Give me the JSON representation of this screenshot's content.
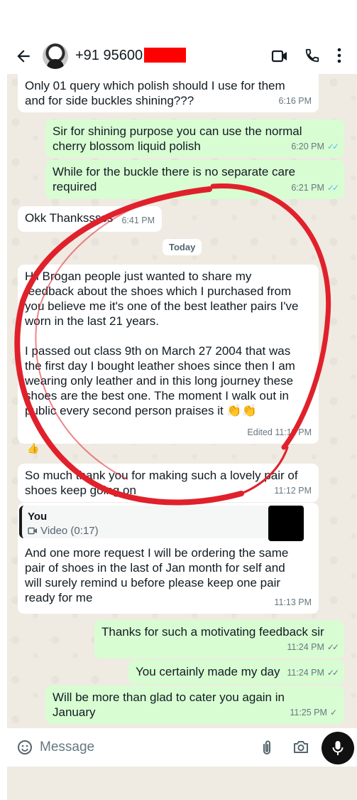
{
  "header": {
    "contact": "+91 95600",
    "icons": [
      "back-arrow-icon",
      "video-call-icon",
      "voice-call-icon",
      "more-options-icon"
    ]
  },
  "messages": [
    {
      "dir": "in",
      "text": "Only 01 query which polish should I use for them\nand for side buckles shining???",
      "time": "6:16 PM"
    },
    {
      "dir": "out",
      "text": "Sir for shining purpose you can use the normal\ncherry blossom liquid polish",
      "time": "6:20 PM",
      "ticks": "read"
    },
    {
      "dir": "out",
      "text": "While for the buckle there is no separate care\nrequired",
      "time": "6:21 PM",
      "ticks": "read"
    },
    {
      "dir": "in",
      "text": "Okk Thanksssss",
      "time": "6:41 PM"
    },
    {
      "dir": "in",
      "text": "Hii Brogan people just wanted to share my\nfeedback about the shoes which I purchased from\nyou believe me it's one of the best leather pairs I've\nworn in the last 21 years.\n\nI passed out class 9th on March 27 2004 that was\nthe first day I bought leather shoes since then I am\nwearing only leather and in this long journey these\nshoes are the best one. The moment I walk out in\npublic every second person praises it 👏👏",
      "time": "Edited 11:11 PM"
    },
    {
      "dir": "in",
      "text": "So much thank you for making such a lovely pair of\nshoes keep going on",
      "time": "11:12 PM"
    },
    {
      "dir": "in",
      "text": "And one more request I will be ordering the same\npair of shoes in the last of Jan month for self and\nwill surely remind u before please keep one pair\nready for me",
      "time": "11:13 PM",
      "quote": {
        "author": "You",
        "label": "Video (0:17)"
      }
    },
    {
      "dir": "out",
      "text": "Thanks for such a motivating feedback sir",
      "time": "11:24 PM",
      "ticks": "delivered"
    },
    {
      "dir": "out",
      "text": "You certainly made my day",
      "time": "11:24 PM",
      "ticks": "delivered"
    },
    {
      "dir": "out",
      "text": "Will be more than glad to cater you again in\nJanuary",
      "time": "11:25 PM",
      "ticks": "sent"
    }
  ],
  "date_chip": "Today",
  "reaction": "👍",
  "composer": {
    "placeholder": "Message",
    "icons": [
      "emoji-icon",
      "attach-icon",
      "camera-icon",
      "mic-icon"
    ]
  },
  "colors": {
    "incoming": "#ffffff",
    "outgoing": "#d9fdd3",
    "background": "#efeae2",
    "read_tick": "#53bdeb",
    "annotation": "#e0212b",
    "redaction": "#ff0000"
  }
}
